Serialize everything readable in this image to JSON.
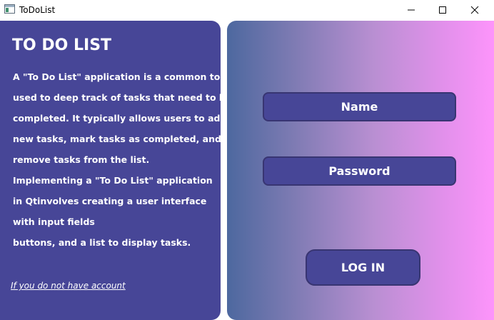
{
  "window": {
    "title": "ToDoList",
    "icon": "app-window-icon",
    "controls": {
      "minimize": "minimize-icon",
      "maximize": "maximize-icon",
      "close": "close-icon"
    }
  },
  "left_panel": {
    "title": "TO DO LIST",
    "description_lines": [
      "A \"To Do List\" application is a common tool",
      "used to deep track of tasks that need to be",
      "completed. It typically allows users to add",
      "new tasks, mark tasks as completed, and",
      "remove tasks from the list.",
      "Implementing a \"To Do List\" application",
      "in Qtinvolves creating a user interface",
      "with input fields",
      "buttons, and a list to display tasks."
    ],
    "signup_link": "If you do not have account"
  },
  "login_form": {
    "name_placeholder": "Name",
    "name_value": "",
    "password_value": "Password",
    "login_label": "LOG IN"
  },
  "colors": {
    "panel": "#474697",
    "field_border": "#383572",
    "gradient_start": "#4d689f",
    "gradient_end": "#fd94fb",
    "text": "#ffffff"
  }
}
